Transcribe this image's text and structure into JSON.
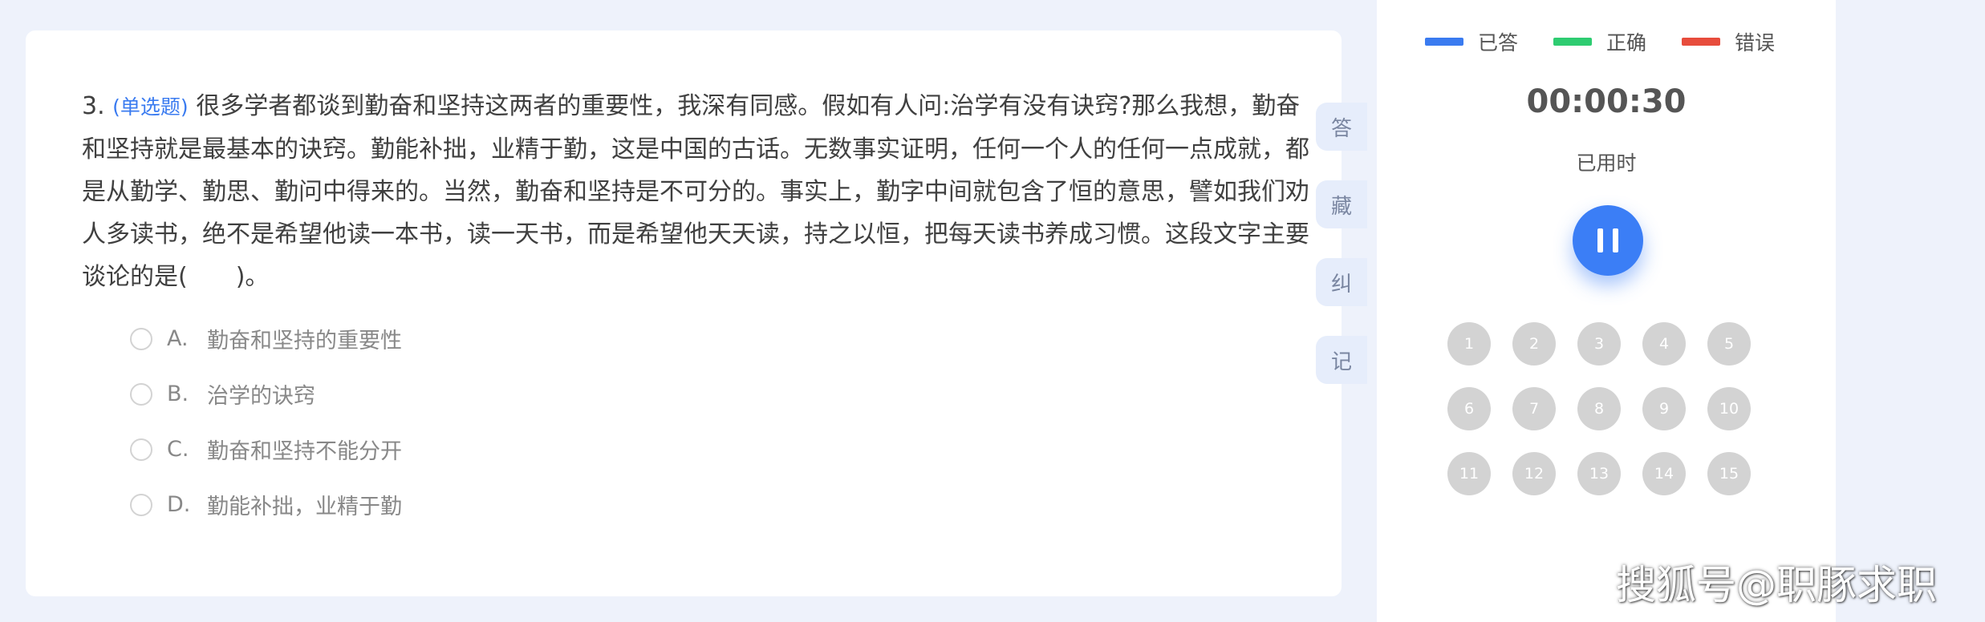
{
  "question": {
    "number": "3.",
    "type_label": "(单选题)",
    "text": "很多学者都谈到勤奋和坚持这两者的重要性，我深有同感。假如有人问:治学有没有诀窍?那么我想，勤奋和坚持就是最基本的诀窍。勤能补拙，业精于勤，这是中国的古话。无数事实证明，任何一个人的任何一点成就，都是从勤学、勤思、勤问中得来的。当然，勤奋和坚持是不可分的。事实上，勤字中间就包含了恒的意思，譬如我们劝人多读书，绝不是希望他读一本书，读一天书，而是希望他天天读，持之以恒，把每天读书养成习惯。这段文字主要谈论的是(　　)。"
  },
  "options": [
    {
      "letter": "A.",
      "text": "勤奋和坚持的重要性"
    },
    {
      "letter": "B.",
      "text": "治学的诀窍"
    },
    {
      "letter": "C.",
      "text": "勤奋和坚持不能分开"
    },
    {
      "letter": "D.",
      "text": "勤能补拙，业精于勤"
    }
  ],
  "side_tools": [
    "答",
    "藏",
    "纠",
    "记"
  ],
  "legend": [
    {
      "label": "已答",
      "color": "#3a7bf0"
    },
    {
      "label": "正确",
      "color": "#2ecc71"
    },
    {
      "label": "错误",
      "color": "#e74c3c"
    }
  ],
  "timer": {
    "value": "00:00:30",
    "label": "已用时"
  },
  "question_numbers": [
    "1",
    "2",
    "3",
    "4",
    "5",
    "6",
    "7",
    "8",
    "9",
    "10",
    "11",
    "12",
    "13",
    "14",
    "15"
  ],
  "watermark": "搜狐号@职豚求职"
}
